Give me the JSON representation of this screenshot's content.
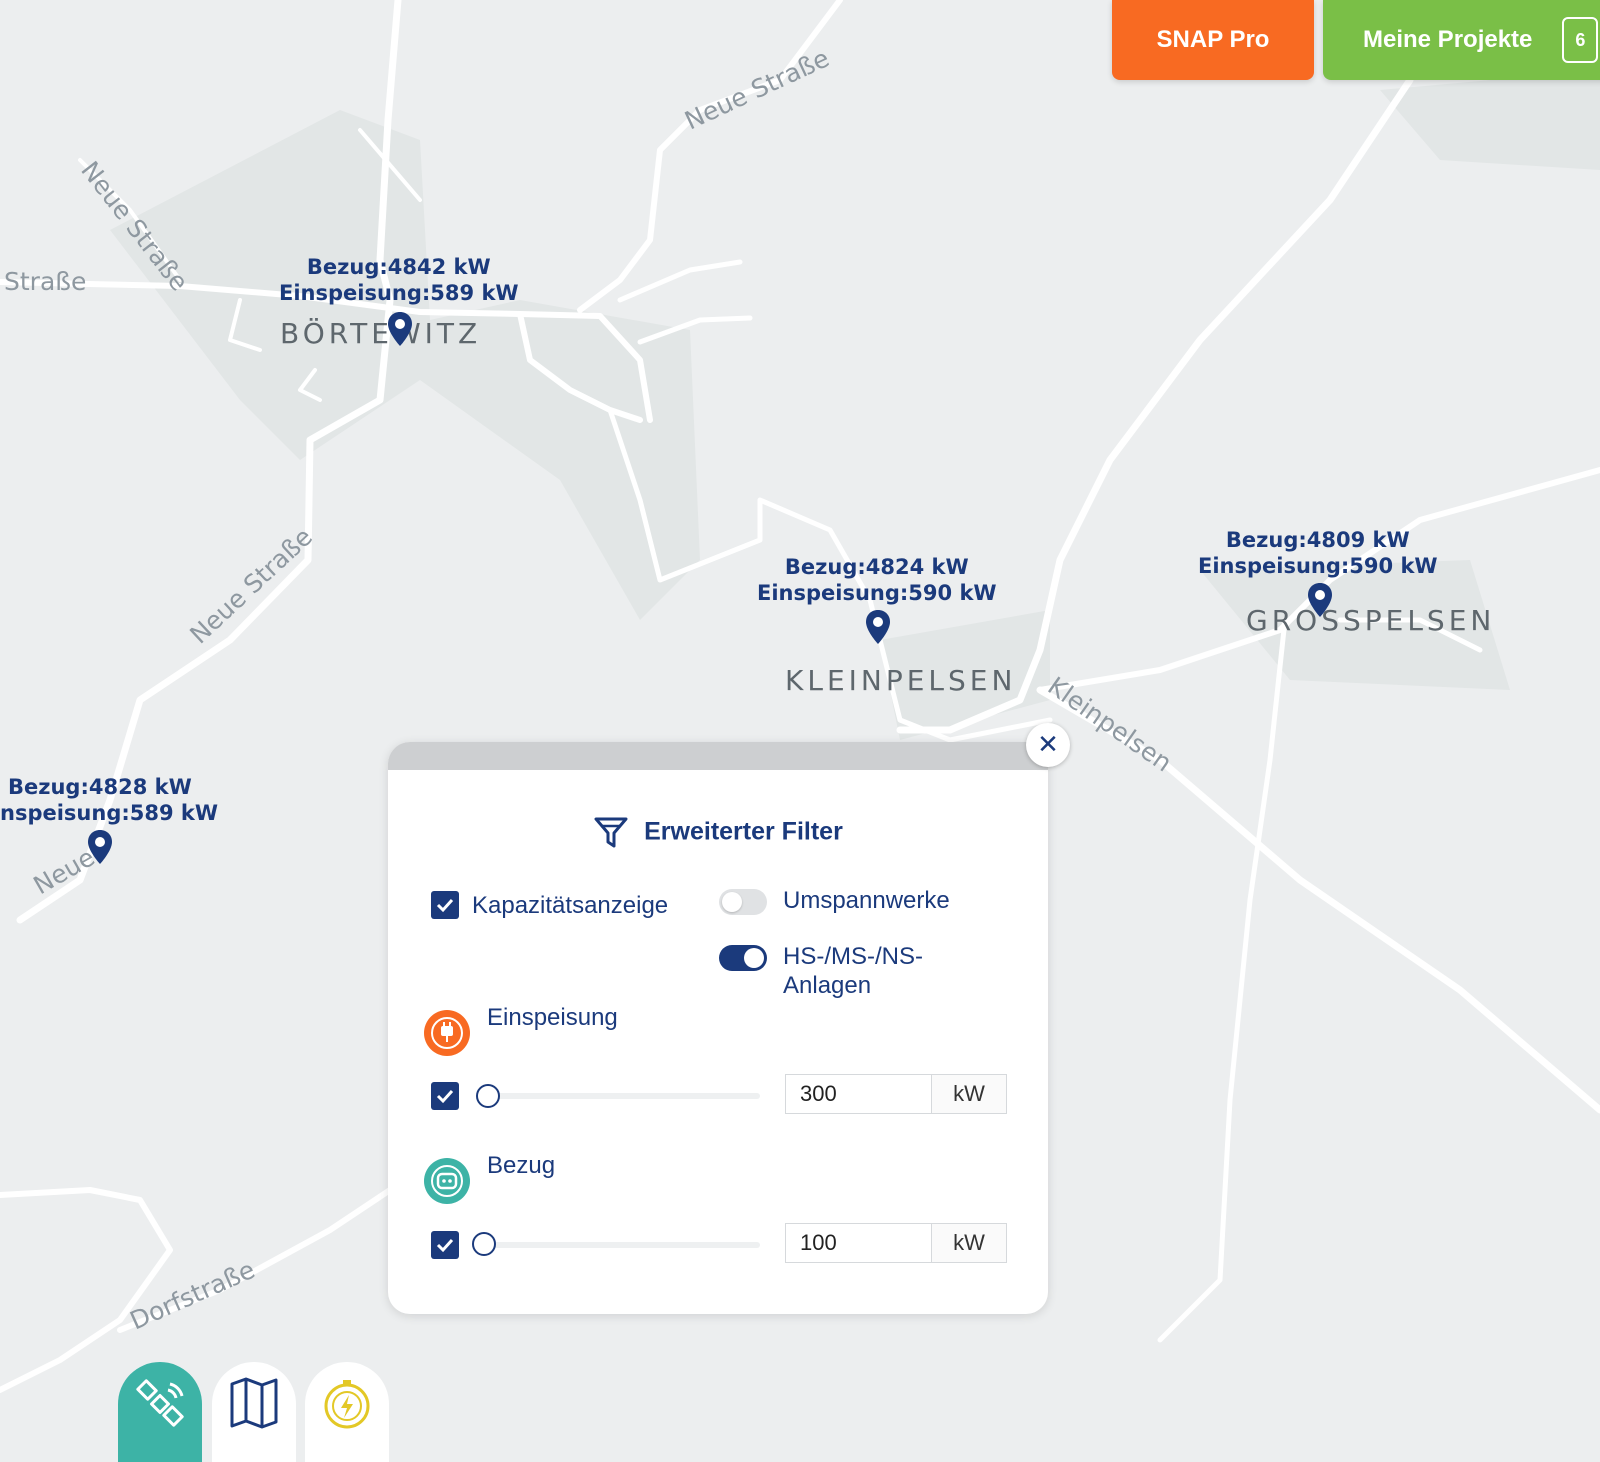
{
  "header": {
    "snap_pro_label": "SNAP Pro",
    "projects_label": "Meine Projekte",
    "projects_count": "6"
  },
  "map": {
    "streets": [
      "Neue Straße",
      "Neue Straße",
      "Straße",
      "Neue Straße",
      "Neue",
      "Kleinpelsen",
      "Dorfstraße"
    ],
    "places": [
      "BÖRTEWITZ",
      "KLEINPELSEN",
      "GROSSPELSEN"
    ],
    "markers": [
      {
        "bezug": "Bezug:4842 kW",
        "einspeisung": "Einspeisung:589 kW"
      },
      {
        "bezug": "Bezug:4824 kW",
        "einspeisung": "Einspeisung:590 kW"
      },
      {
        "bezug": "Bezug:4809 kW",
        "einspeisung": "Einspeisung:590 kW"
      },
      {
        "bezug": "Bezug:4828 kW",
        "einspeisung": "nspeisung:589 kW"
      }
    ]
  },
  "filter": {
    "title": "Erweiterter Filter",
    "close_icon": "close-icon",
    "kapazitaet_label": "Kapazitätsanzeige",
    "kapazitaet_checked": true,
    "umspannwerke_label": "Umspannwerke",
    "umspannwerke_on": false,
    "anlagen_label": "HS-/MS-/NS-Anlagen",
    "anlagen_on": true,
    "einspeisung": {
      "label": "Einspeisung",
      "value": "300",
      "unit": "kW",
      "color": "#f86a22",
      "checked": true,
      "slider_fraction": 0.0
    },
    "bezug": {
      "label": "Bezug",
      "value": "100",
      "unit": "kW",
      "color": "#3db3a6",
      "checked": true,
      "slider_fraction": 0.0
    }
  },
  "colors": {
    "primary": "#1b3a7c",
    "snap_pro": "#f86a22",
    "projects": "#7abf47",
    "map_bg": "#eceeef"
  },
  "map_modes": [
    "satellite-icon",
    "map-icon",
    "energy-icon"
  ]
}
